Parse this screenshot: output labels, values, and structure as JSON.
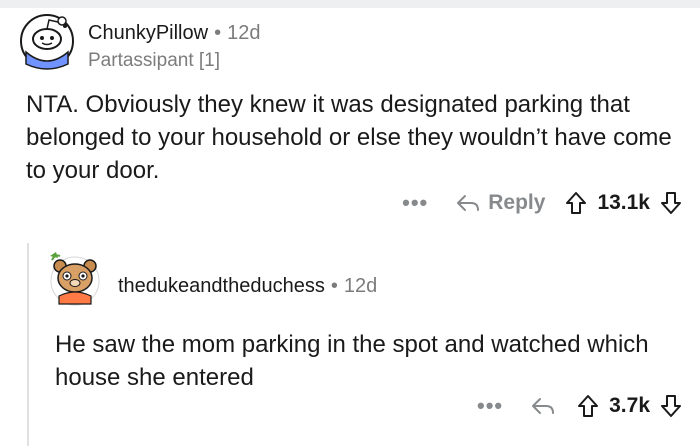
{
  "comments": [
    {
      "username": "ChunkyPillow",
      "age": "12d",
      "flair": "Partassipant [1]",
      "body": "NTA. Obviously they knew it was designated parking that belonged to your household or else they wouldn’t have come to your door.",
      "more": "•••",
      "reply_label": "Reply",
      "score": "13.1k"
    },
    {
      "username": "thedukeandtheduchess",
      "age": "12d",
      "body": "He saw the mom parking in the spot and watched which house she entered",
      "more": "•••",
      "score": "3.7k"
    }
  ],
  "separator": "•",
  "icons": {
    "reply": "reply-arrow-icon",
    "upvote": "upvote-arrow-icon",
    "downvote": "downvote-arrow-icon",
    "avatar1": "snoo-avatar",
    "avatar2": "bear-avatar"
  },
  "colors": {
    "text": "#1a1a1b",
    "meta": "#7c7c7c",
    "action": "#878a8c",
    "thread_line": "#e0e0e0",
    "topbar": "#edeff1"
  }
}
